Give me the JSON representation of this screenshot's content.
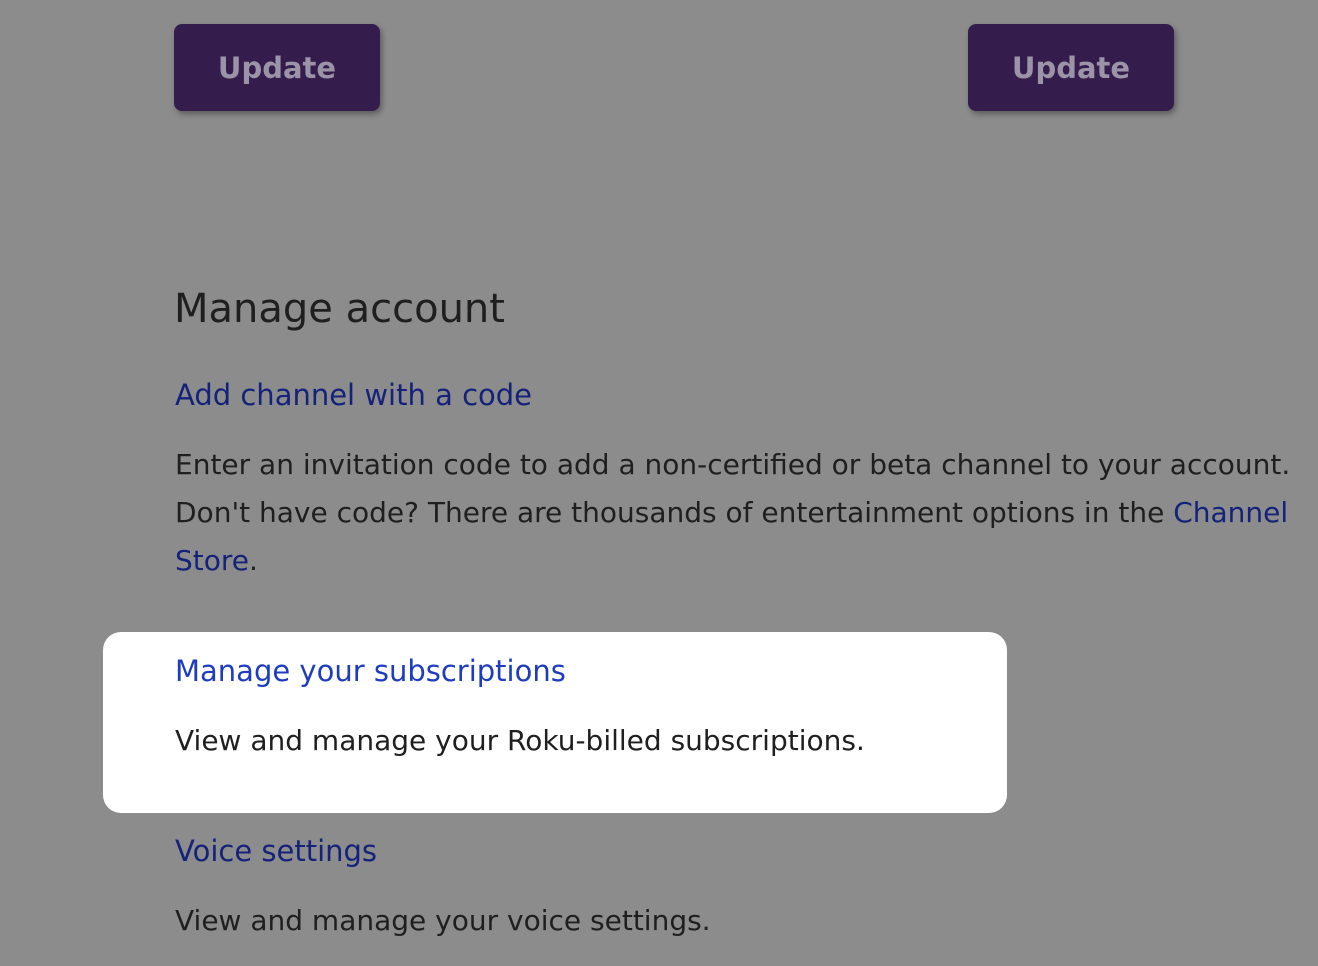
{
  "buttons": {
    "left_label": "Update",
    "right_label": "Update"
  },
  "manage_account": {
    "title": "Manage account",
    "add_channel": {
      "link": "Add channel with a code",
      "desc_prefix": "Enter an invitation code to add a non-certified or beta channel to your account. Don't have code? There are thousands of entertainment options in the ",
      "store_link": "Channel Store",
      "desc_suffix": "."
    },
    "subscriptions": {
      "link": "Manage your subscriptions",
      "desc": "View and manage your Roku-billed subscriptions."
    },
    "voice": {
      "link": "Voice settings",
      "desc": "View and manage your voice settings."
    }
  },
  "colors": {
    "background": "#8c8c8c",
    "button_bg": "#341d4c",
    "link": "#14227a",
    "highlight_link": "#1d3cc0",
    "highlight_card": "#ffffff"
  }
}
